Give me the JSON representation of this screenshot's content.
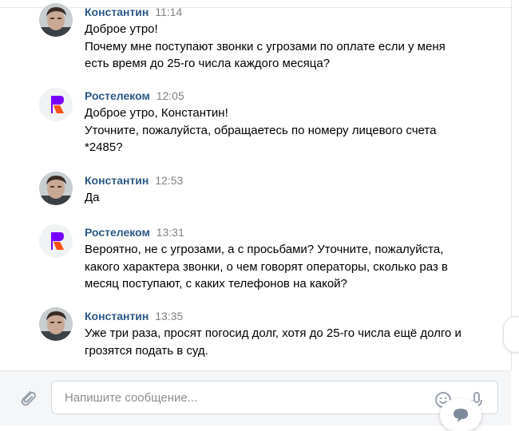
{
  "messages": [
    {
      "sender": "Константин",
      "time": "11:14",
      "avatar": "user-avatar",
      "lines": [
        "Доброе утро!",
        "Почему мне поступают звонки с угрозами по оплате если у меня",
        "есть время до 25-го числа каждого месяца?"
      ]
    },
    {
      "sender": "Ростелеком",
      "time": "12:05",
      "avatar": "company-logo",
      "lines": [
        "Доброе утро, Константин!",
        "Уточните, пожалуйста, обращаетесь по номеру лицевого счета",
        "*2485?"
      ]
    },
    {
      "sender": "Константин",
      "time": "12:53",
      "avatar": "user-avatar",
      "lines": [
        "Да"
      ]
    },
    {
      "sender": "Ростелеком",
      "time": "13:31",
      "avatar": "company-logo",
      "lines": [
        "Вероятно, не с угрозами, а с просьбами? Уточните, пожалуйста,",
        "какого характера звонки, о чем говорят операторы, сколько раз в",
        "месяц поступают, с каких телефонов на какой?"
      ]
    },
    {
      "sender": "Константин",
      "time": "13:35",
      "avatar": "user-avatar",
      "lines": [
        "Уже три раза, просят погосид долг, хотя до 25-го числа ещё долго и",
        "грозятся подать в суд."
      ]
    }
  ],
  "composer": {
    "placeholder": "Напишите сообщение..."
  },
  "icons": {
    "attach": "paperclip-icon",
    "emoji": "emoji-icon",
    "voice": "microphone-icon",
    "fab": "chat-bubble-icon"
  },
  "colors": {
    "sender_name": "#2a5885",
    "timestamp": "#828282",
    "brand_orange": "#ff4f12",
    "brand_purple": "#7800ff"
  }
}
